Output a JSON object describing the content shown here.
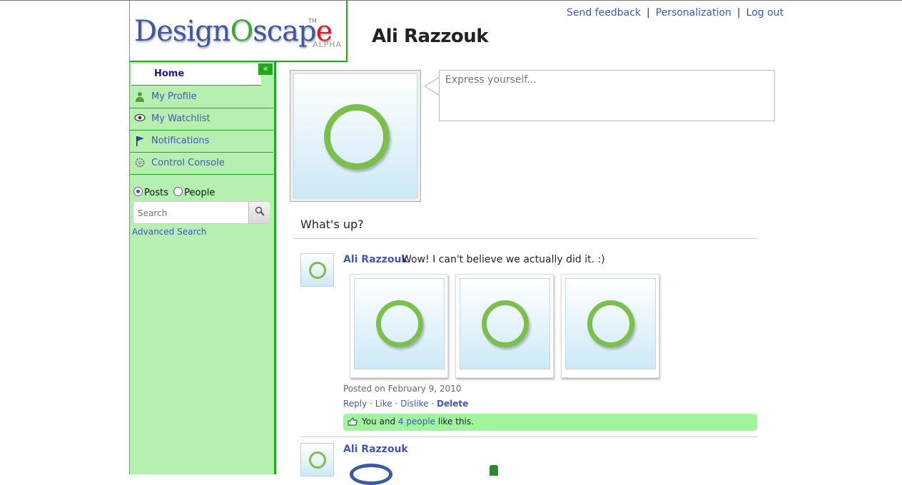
{
  "logo": {
    "brand": "DesignOscape",
    "brand_main": "Design",
    "brand_o": "O",
    "brand_mid": "scap",
    "brand_e": "e",
    "tm": "TM",
    "tag": "ALPHA"
  },
  "header": {
    "links": [
      "Send feedback",
      "Personalization",
      "Log out"
    ],
    "separator": "|",
    "title": "Ali Razzouk"
  },
  "sidebar": {
    "collapse_label": "«",
    "home_label": "Home",
    "items": [
      {
        "label": "My Profile",
        "icon": "profile-icon"
      },
      {
        "label": "My Watchlist",
        "icon": "eye-icon"
      },
      {
        "label": "Notifications",
        "icon": "flag-icon"
      },
      {
        "label": "Control Console",
        "icon": "gear-icon"
      }
    ],
    "search": {
      "radio_posts": "Posts",
      "radio_people": "People",
      "selected": "Posts",
      "placeholder": "Search",
      "advanced_label": "Advanced Search"
    }
  },
  "status": {
    "placeholder": "Express yourself..."
  },
  "feed": {
    "heading": "What's up?",
    "posts": [
      {
        "author": "Ali Razzouk",
        "text": "Wow! I can't believe we actually did it. :)",
        "date": "Posted on February 9, 2010",
        "actions": [
          "Reply",
          "Like",
          "Dislike",
          "Delete"
        ],
        "action_sep": "·",
        "likes": {
          "prefix": "You and",
          "link": "4 people",
          "suffix": "like this."
        }
      },
      {
        "author": "Ali Razzouk"
      }
    ]
  },
  "colors": {
    "accent_green": "#22a81e",
    "sidebar_bg": "#b5f0b0",
    "link_blue": "#3f57b8",
    "likes_bg": "#9ff59c"
  }
}
